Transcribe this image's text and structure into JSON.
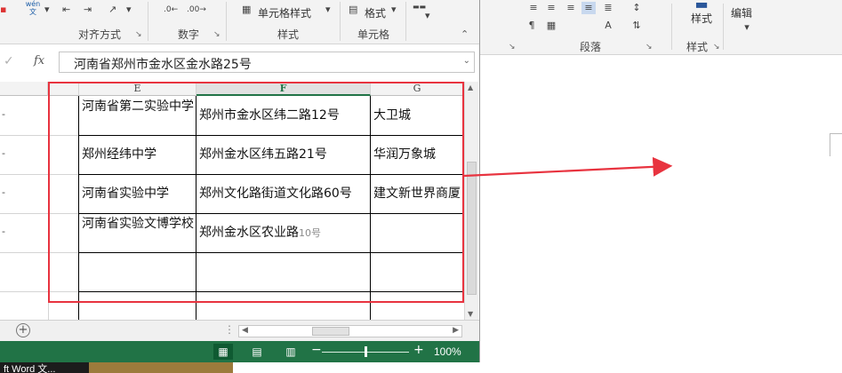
{
  "word": {
    "ribbon": {
      "groups": {
        "paragraph": "段落",
        "styles": "样式"
      },
      "styles_button": "样式",
      "editing_button": "编辑"
    }
  },
  "excel": {
    "ribbon": {
      "phonetic_icon": "wén\n文",
      "cell_styles_button": "单元格样式",
      "format_button": "格式",
      "groups": {
        "alignment": "对齐方式",
        "number": "数字",
        "styles": "样式",
        "cells": "单元格"
      }
    },
    "formula_bar": {
      "fx": "fx",
      "content": "河南省郑州市金水区金水路25号"
    },
    "columns": [
      {
        "label": "E",
        "active": false
      },
      {
        "label": "F",
        "active": true
      },
      {
        "label": "G",
        "active": false
      }
    ],
    "rows": [
      {
        "e": "河南省第二实验中学",
        "f": "郑州市金水区纬二路12号",
        "f_small": "",
        "g": "大卫城"
      },
      {
        "e": "郑州经纬中学",
        "f": "郑州金水区纬五路21号",
        "f_small": "",
        "g": "华润万象城"
      },
      {
        "e": "河南省实验中学",
        "f": "郑州文化路街道文化路60号",
        "f_small": "",
        "g": "建文新世界商厦"
      },
      {
        "e": "河南省实验文博学校",
        "f": "郑州金水区农业路",
        "f_small": "10号",
        "g": ""
      }
    ],
    "status_bar": {
      "zoom_level": "100%",
      "zoom_fraction": 0.5
    }
  },
  "taskbar": {
    "item_label": "ft Word 文..."
  },
  "colors": {
    "excel_green": "#217346",
    "highlight_red": "#e8333f",
    "word_blue": "#2b579a"
  }
}
